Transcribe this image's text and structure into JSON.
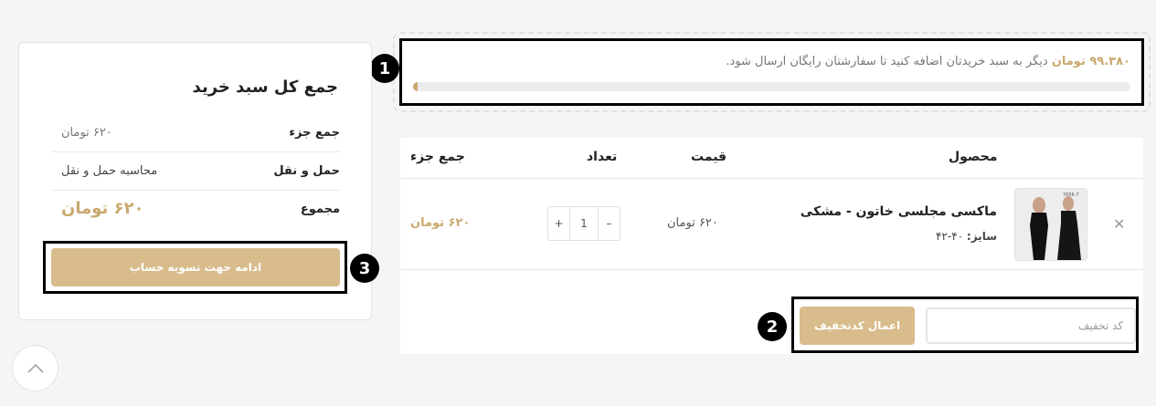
{
  "notice": {
    "amount": "۹۹.۳۸۰ تومان",
    "text": " دیگر به سبد خریدتان اضافه کنید تا سفارشتان رایگان ارسال شود.",
    "progress": 0.006
  },
  "badges": [
    "1",
    "2",
    "3"
  ],
  "cart": {
    "headers": {
      "product": "محصول",
      "price": "قیمت",
      "quantity": "تعداد",
      "subtotal": "جمع جزء"
    },
    "item": {
      "remove_icon": "close-icon",
      "image_text": "7656-7",
      "name": "ماکسی مجلسی خاتون - مشکی",
      "size_label": "سایز:",
      "size_value": "۴۰-۴۲",
      "price": "۶۲۰ تومان",
      "quantity": "1",
      "minus": "–",
      "plus": "+",
      "subtotal": "۶۲۰ تومان"
    },
    "coupon": {
      "placeholder": "کد تخفیف",
      "button_label": "اعمال کدتخفیف"
    }
  },
  "totals": {
    "title": "جمع کل سبد خرید",
    "subtotal_label": "جمع جزء",
    "subtotal_value": "۶۲۰ تومان",
    "shipping_label": "حمل و نقل",
    "shipping_value": "محاسبه حمل و نقل",
    "total_label": "مجموع",
    "total_value": "۶۲۰ تومان",
    "checkout_label": "ادامه جهت تسویه حساب"
  },
  "scroll_top_icon": "chevron-up-icon",
  "colors": {
    "accent": "#c9a96e",
    "button": "#d9bc8c",
    "background": "#f5f5f5"
  }
}
